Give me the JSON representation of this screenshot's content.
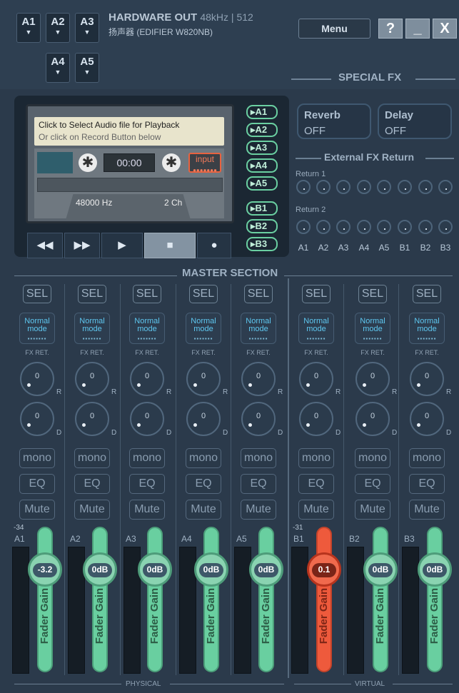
{
  "header": {
    "bus_buttons": [
      "A1",
      "A2",
      "A3",
      "A4",
      "A5"
    ],
    "hw_title": "HARDWARE OUT",
    "hw_sub": "48kHz | 512",
    "hw_device": "扬声器 (EDIFIER W820NB)",
    "menu_label": "Menu",
    "help_label": "?",
    "minimize_label": "_",
    "close_label": "X",
    "special_fx": "SPECIAL FX"
  },
  "cassette": {
    "msg_line1": "Click to Select Audio file for Playback",
    "msg_line2": "Or click on Record Button below",
    "time": "00:00",
    "input_label": "input",
    "freq": "48000 Hz",
    "channels": "2 Ch",
    "transport": [
      "rewind",
      "fast-forward",
      "play",
      "stop",
      "record"
    ],
    "outputs": [
      "A1",
      "A2",
      "A3",
      "A4",
      "A5",
      "B1",
      "B2",
      "B3"
    ]
  },
  "fx": {
    "reverb_label": "Reverb",
    "reverb_value": "OFF",
    "delay_label": "Delay",
    "delay_value": "OFF",
    "ext_title": "External FX Return",
    "return1": "Return 1",
    "return2": "Return 2",
    "return_cols": [
      "A1",
      "A2",
      "A3",
      "A4",
      "A5",
      "B1",
      "B2",
      "B3"
    ]
  },
  "master": {
    "title": "MASTER SECTION",
    "sel_label": "SEL",
    "mode_line1": "Normal",
    "mode_line2": "mode",
    "fxret_label": "FX RET.",
    "knob_r_label": "R",
    "knob_d_label": "D",
    "knob_value": "0",
    "mono_label": "mono",
    "eq_label": "EQ",
    "mute_label": "Mute",
    "fader_text": "Fader Gain",
    "physical_label": "PHYSICAL",
    "virtual_label": "VIRTUAL",
    "strips": [
      {
        "name": "A1",
        "gain": "-3.2",
        "peak": "-34",
        "active": false
      },
      {
        "name": "A2",
        "gain": "0dB",
        "peak": "",
        "active": false
      },
      {
        "name": "A3",
        "gain": "0dB",
        "peak": "",
        "active": false
      },
      {
        "name": "A4",
        "gain": "0dB",
        "peak": "",
        "active": false
      },
      {
        "name": "A5",
        "gain": "0dB",
        "peak": "",
        "active": false
      },
      {
        "name": "B1",
        "gain": "0.1",
        "peak": "-31",
        "active": true
      },
      {
        "name": "B2",
        "gain": "0dB",
        "peak": "",
        "active": false
      },
      {
        "name": "B3",
        "gain": "0dB",
        "peak": "",
        "active": false
      }
    ]
  },
  "colors": {
    "accent_green": "#69cfa0",
    "accent_red": "#ee5a3c",
    "mode_blue": "#5ec7f0",
    "background": "#2b3a4b"
  }
}
